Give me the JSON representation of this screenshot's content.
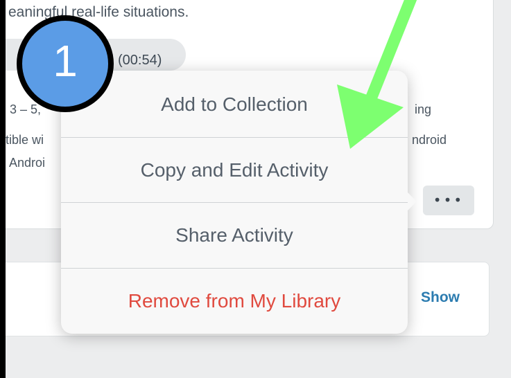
{
  "card": {
    "description_fragment": "eaningful real-life situations.",
    "duration": "(00:54)",
    "ages_fragment": "3 – 5, ",
    "ages_suffix": "ing",
    "compat_line1_left": "tible wi",
    "compat_line1_right": "ndroid",
    "compat_line2_left": ", Androi",
    "more_label": "•••"
  },
  "bottom_card": {
    "show_label": "Show"
  },
  "menu": {
    "items": [
      {
        "label": "Add to Collection"
      },
      {
        "label": "Copy and Edit Activity"
      },
      {
        "label": "Share Activity"
      },
      {
        "label": "Remove from My Library"
      }
    ],
    "danger_color": "#e04a3f"
  },
  "annotation": {
    "step_number": "1",
    "badge_color": "#5b9ce6",
    "arrow_color": "#7dff70"
  }
}
